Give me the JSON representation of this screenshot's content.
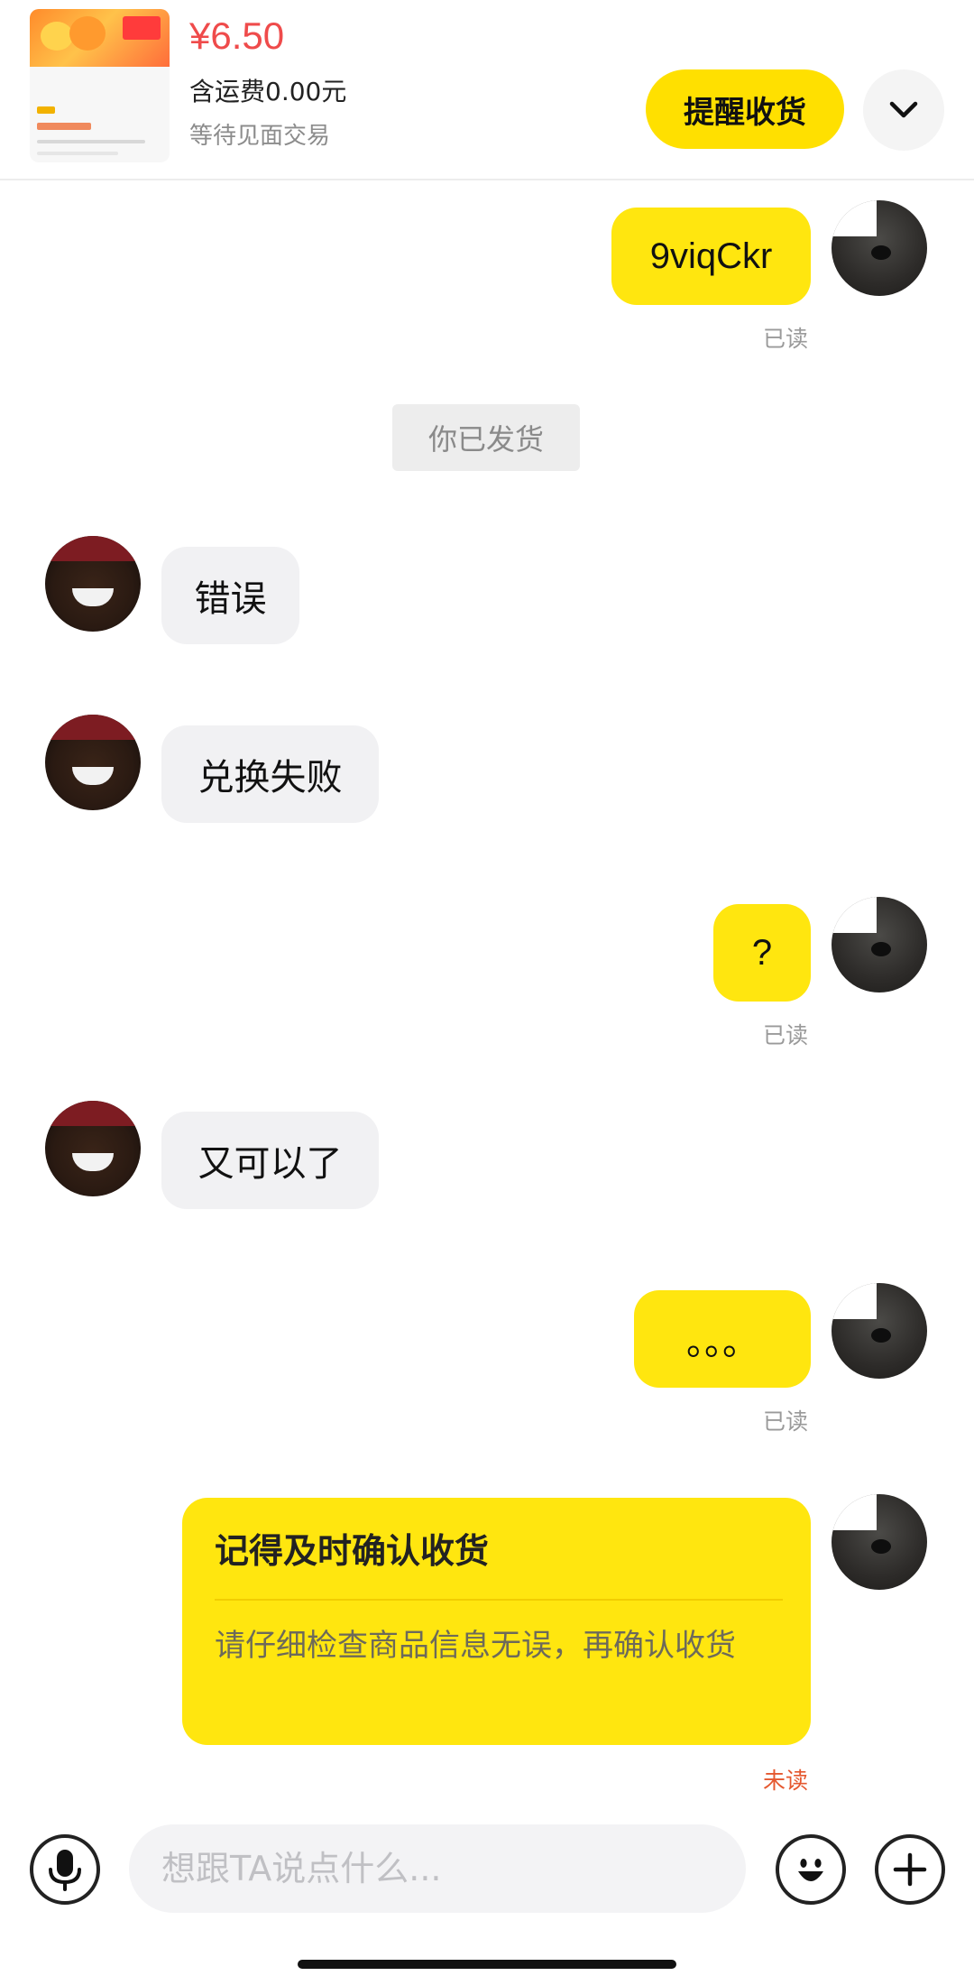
{
  "header": {
    "price": "¥6.50",
    "shipping": "含运费0.00元",
    "status": "等待见面交易",
    "remind_button": "提醒收货",
    "more_icon": "chevron-down-icon"
  },
  "messages": [
    {
      "side": "out",
      "text": "9viqCkr",
      "receipt": "已读"
    },
    {
      "side": "system",
      "text": "你已发货"
    },
    {
      "side": "in",
      "text": "错误"
    },
    {
      "side": "in",
      "text": "兑换失败"
    },
    {
      "side": "out",
      "text": "?",
      "receipt": "已读"
    },
    {
      "side": "in",
      "text": "又可以了"
    },
    {
      "side": "out",
      "text": "。。。",
      "receipt": "已读"
    }
  ],
  "reminder_card": {
    "title": "记得及时确认收货",
    "body": "请仔细检查商品信息无误，再确认收货",
    "receipt": "未读"
  },
  "composer": {
    "placeholder": "想跟TA说点什么...",
    "voice_icon": "microphone-icon",
    "emoji_icon": "emoji-icon",
    "plus_icon": "plus-icon"
  },
  "colors": {
    "accent_yellow": "#ffe60f",
    "price_red": "#ef4b4b",
    "unread_orange": "#e5582f"
  }
}
